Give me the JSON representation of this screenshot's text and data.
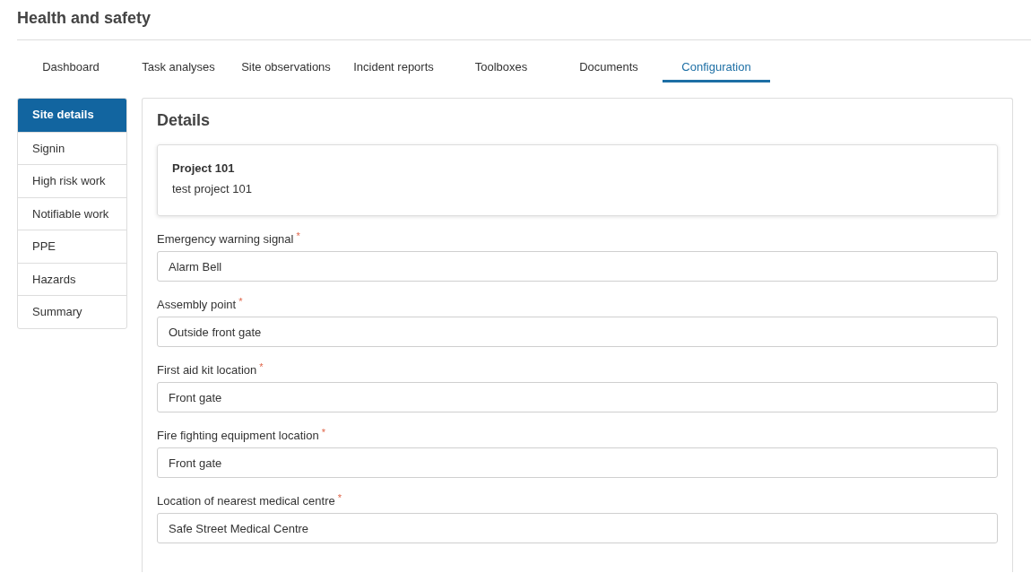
{
  "page_title": "Health and safety",
  "tabs": [
    {
      "label": "Dashboard",
      "selected": false
    },
    {
      "label": "Task analyses",
      "selected": false
    },
    {
      "label": "Site observations",
      "selected": false
    },
    {
      "label": "Incident reports",
      "selected": false
    },
    {
      "label": "Toolboxes",
      "selected": false
    },
    {
      "label": "Documents",
      "selected": false
    },
    {
      "label": "Configuration",
      "selected": true
    }
  ],
  "sidebar": {
    "items": [
      {
        "label": "Site details",
        "selected": true
      },
      {
        "label": "Signin",
        "selected": false
      },
      {
        "label": "High risk work",
        "selected": false
      },
      {
        "label": "Notifiable work",
        "selected": false
      },
      {
        "label": "PPE",
        "selected": false
      },
      {
        "label": "Hazards",
        "selected": false
      },
      {
        "label": "Summary",
        "selected": false
      }
    ]
  },
  "details": {
    "heading": "Details",
    "project": {
      "name": "Project 101",
      "description": "test project 101"
    },
    "fields": [
      {
        "label": "Emergency warning signal",
        "required_mark": "*",
        "value": "Alarm Bell"
      },
      {
        "label": "Assembly point",
        "required_mark": "*",
        "value": "Outside front gate"
      },
      {
        "label": "First aid kit location",
        "required_mark": "*",
        "value": "Front gate"
      },
      {
        "label": "Fire fighting equipment location",
        "required_mark": "*",
        "value": "Front gate"
      },
      {
        "label": "Location of nearest medical centre",
        "required_mark": "*",
        "value": "Safe Street Medical Centre"
      }
    ]
  }
}
